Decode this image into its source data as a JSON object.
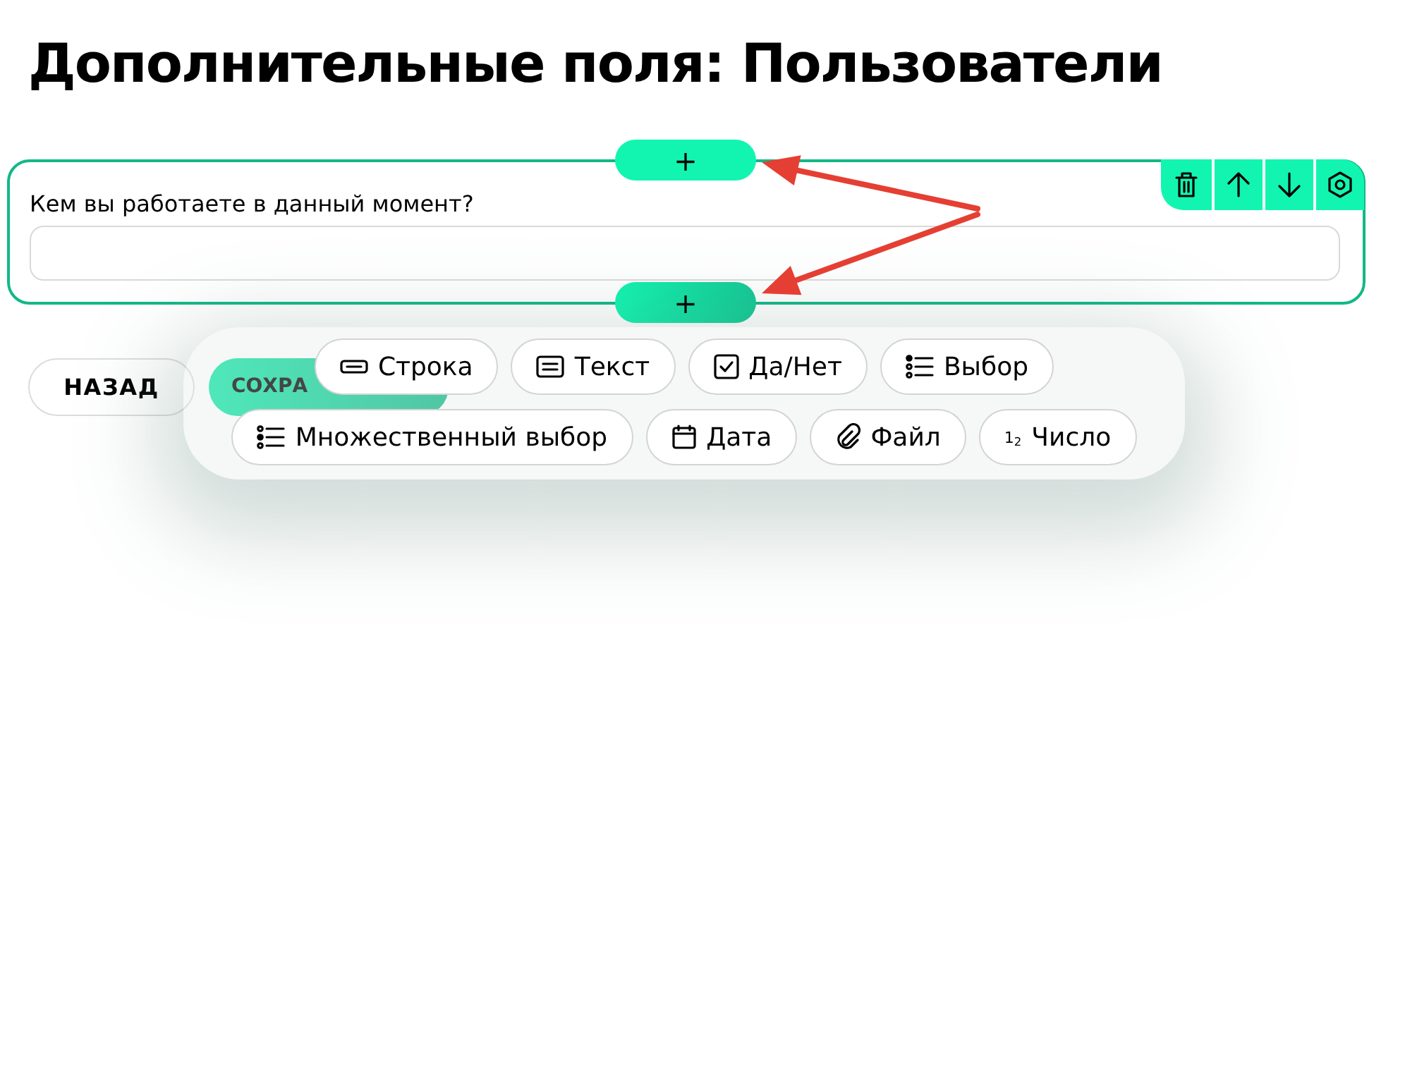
{
  "title": "Дополнительные поля: Пользователи",
  "field": {
    "label": "Кем вы работаете в данный момент?",
    "add_above": "+",
    "add_below": "+",
    "tools": [
      {
        "kind": "delete"
      },
      {
        "kind": "up"
      },
      {
        "kind": "down"
      },
      {
        "kind": "settings"
      }
    ]
  },
  "buttons": [
    {
      "label": "НАЗАД",
      "kind": "outline"
    },
    {
      "label": "СОХРА",
      "kind": "primary"
    }
  ],
  "type_menu": {
    "rows": [
      [
        {
          "label": "Строка",
          "kind": "string"
        },
        {
          "label": "Текст",
          "kind": "text"
        },
        {
          "label": "Да/Нет",
          "kind": "bool"
        },
        {
          "label": "Выбор",
          "kind": "choice"
        }
      ],
      [
        {
          "label": "Множественный выбор",
          "kind": "multi"
        },
        {
          "label": "Дата",
          "kind": "date"
        },
        {
          "label": "Файл",
          "kind": "file"
        },
        {
          "label": "Число",
          "kind": "number",
          "icon_text": "1$_{2}$"
        }
      ]
    ]
  },
  "annotations": [
    {
      "kind": "arrow"
    },
    {
      "kind": "arrow"
    }
  ]
}
